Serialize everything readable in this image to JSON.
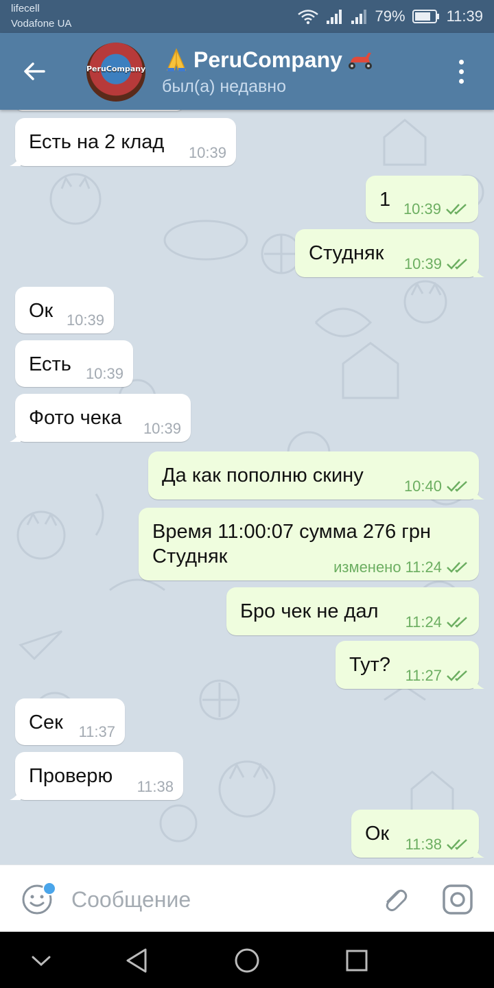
{
  "status_bar": {
    "carrier_1": "lifecell",
    "carrier_2": "Vodafone UA",
    "battery": "79%",
    "time": "11:39"
  },
  "header": {
    "title": "PeruCompany",
    "status": "был(а) недавно",
    "avatar_icon": "PeruCompany"
  },
  "messages": [
    {
      "dir": "in",
      "text": "Есть на 2 клад",
      "time": "10:39"
    },
    {
      "dir": "out",
      "text": "1",
      "time": "10:39",
      "read": true
    },
    {
      "dir": "out",
      "text": "Студняк",
      "time": "10:39",
      "read": true
    },
    {
      "dir": "in",
      "text": "Ок",
      "time": "10:39"
    },
    {
      "dir": "in",
      "text": "Есть",
      "time": "10:39"
    },
    {
      "dir": "in",
      "text": "Фото чека",
      "time": "10:39"
    },
    {
      "dir": "out",
      "text": "Да как пополню скину",
      "time": "10:40",
      "read": true
    },
    {
      "dir": "out",
      "text_line1": "Время 11:00:07 сумма 276 грн",
      "text_line2": "Студняк",
      "edited": "изменено",
      "time": "11:24",
      "read": true
    },
    {
      "dir": "out",
      "text": "Бро чек не дал",
      "time": "11:24",
      "read": true
    },
    {
      "dir": "out",
      "text": "Тут?",
      "time": "11:27",
      "read": true
    },
    {
      "dir": "in",
      "text": "Сек",
      "time": "11:37"
    },
    {
      "dir": "in",
      "text": "Проверю",
      "time": "11:38"
    },
    {
      "dir": "out",
      "text": "Ок",
      "time": "11:38",
      "read": true
    }
  ],
  "input": {
    "placeholder": "Сообщение"
  },
  "colors": {
    "header": "#527da3",
    "status_bar": "#3f5e7c",
    "incoming_bubble": "#ffffff",
    "outgoing_bubble": "#effdde",
    "read_check": "#6cae61",
    "wallpaper": "#d3dde6"
  },
  "icons": [
    "back-arrow-icon",
    "pray-emoji-icon",
    "moped-emoji-icon",
    "more-vert-icon",
    "double-check-icon",
    "emoji-icon",
    "paperclip-icon",
    "camera-icon",
    "nav-back-icon",
    "nav-home-icon",
    "nav-recents-icon",
    "nav-down-icon"
  ]
}
